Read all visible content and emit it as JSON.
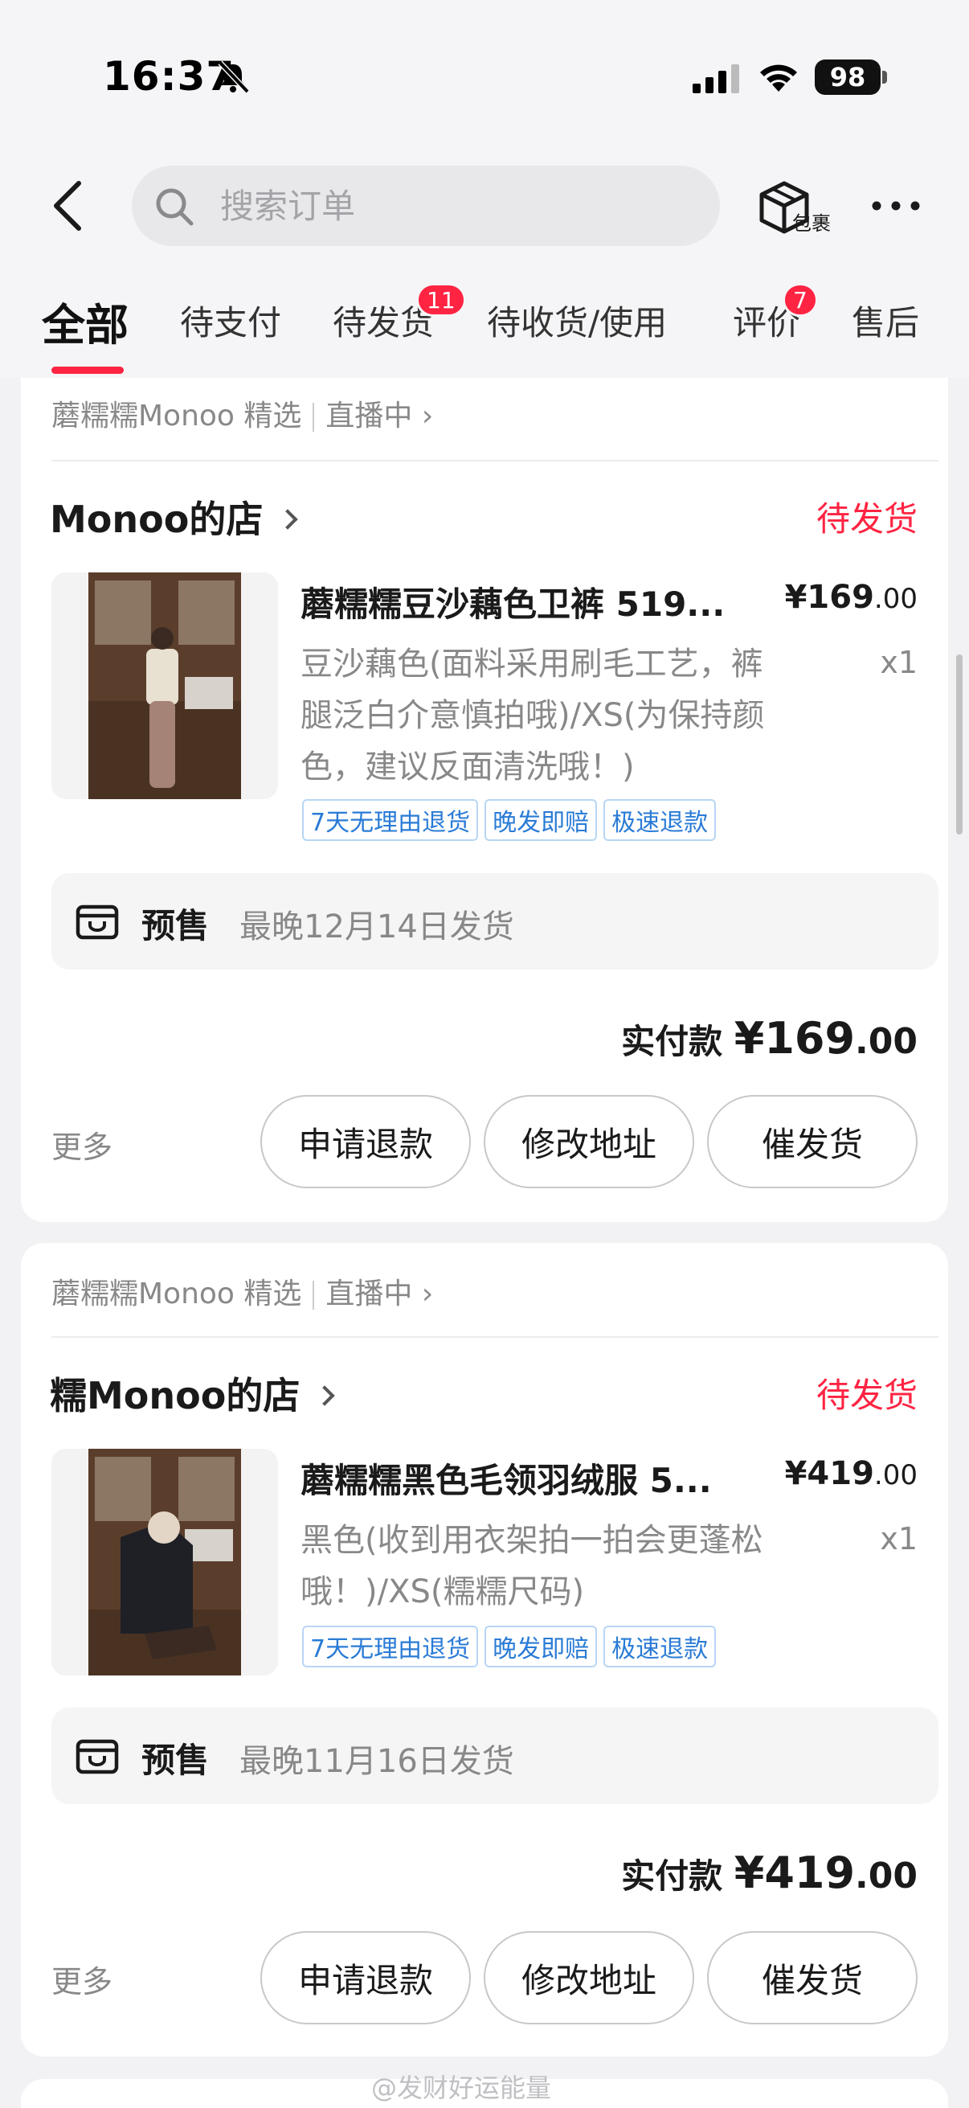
{
  "status_bar": {
    "time": "16:37",
    "battery": "98"
  },
  "header": {
    "search_placeholder": "搜索订单",
    "package_label": "包裹"
  },
  "tabs": [
    {
      "label": "全部",
      "active": true
    },
    {
      "label": "待支付"
    },
    {
      "label": "待发货",
      "badge": "11"
    },
    {
      "label": "待收货/使用"
    },
    {
      "label": "评价",
      "badge": "7"
    },
    {
      "label": "售后"
    }
  ],
  "orders": [
    {
      "source": "蘑糯糯Monoo 精选",
      "live": "直播中",
      "shop": "Monoo的店",
      "status": "待发货",
      "title": "蘑糯糯豆沙藕色卫裤 519...",
      "price_main": "¥169",
      "price_cents": ".00",
      "spec": "豆沙藕色(面料采用刷毛工艺，裤腿泛白介意慎拍哦)/XS(为保持颜色，建议反面清洗哦！)",
      "qty": "x1",
      "tags": [
        "7天无理由退货",
        "晚发即赔",
        "极速退款"
      ],
      "presale_label": "预售",
      "presale_text": "最晚12月14日发货",
      "paid_label": "实付款",
      "paid_main": "¥169",
      "paid_cents": ".00",
      "more": "更多",
      "buttons": [
        "申请退款",
        "修改地址",
        "催发货"
      ]
    },
    {
      "source": "蘑糯糯Monoo 精选",
      "live": "直播中",
      "shop": "糯Monoo的店",
      "status": "待发货",
      "title": "蘑糯糯黑色毛领羽绒服 5...",
      "price_main": "¥419",
      "price_cents": ".00",
      "spec": "黑色(收到用衣架拍一拍会更蓬松哦！)/XS(糯糯尺码)",
      "qty": "x1",
      "tags": [
        "7天无理由退货",
        "晚发即赔",
        "极速退款"
      ],
      "presale_label": "预售",
      "presale_text": "最晚11月16日发货",
      "paid_label": "实付款",
      "paid_main": "¥419",
      "paid_cents": ".00",
      "more": "更多",
      "buttons": [
        "申请退款",
        "修改地址",
        "催发货"
      ]
    }
  ],
  "watermark": "@发财好运能量",
  "colors": {
    "accent": "#ff2442",
    "tag_blue": "#2a7bd6",
    "background": "#f2f2f4"
  },
  "icons": [
    "bell-slash-icon",
    "signal-icon",
    "wifi-icon",
    "back-chevron-icon",
    "search-icon",
    "package-icon",
    "more-dots-icon",
    "presale-box-icon",
    "chevron-right-icon"
  ]
}
